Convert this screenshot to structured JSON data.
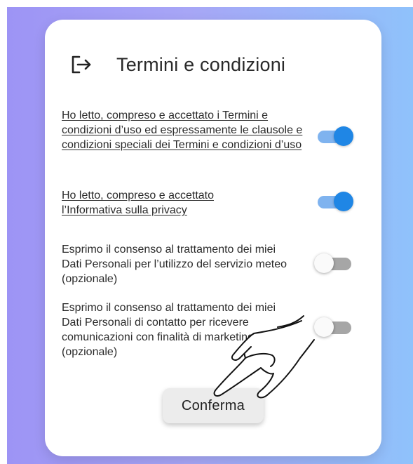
{
  "header": {
    "icon": "logout-icon",
    "title": "Termini e condizioni"
  },
  "consents": [
    {
      "text": "Ho letto, compreso e accettato i Termini e condizioni d’uso ed espressamente le clausole e condizioni speciali dei Termini e condizioni d’uso",
      "is_link": true,
      "enabled": true
    },
    {
      "text": "Ho letto, compreso e accettato l’Informativa sulla privacy",
      "is_link": true,
      "enabled": true
    },
    {
      "text": "Esprimo il consenso al trattamento dei miei Dati Personali per l’utilizzo del servizio meteo (opzionale)",
      "is_link": false,
      "enabled": false
    },
    {
      "text": "Esprimo il consenso al trattamento dei miei Dati Personali di contatto per ricevere comunicazioni con finalità di marketing (opzionale)",
      "is_link": false,
      "enabled": false
    }
  ],
  "confirm_button": {
    "label": "Conferma"
  },
  "colors": {
    "toggle_on_thumb": "#1f86e5",
    "toggle_on_track": "#7fb3ef",
    "toggle_off_track": "#a6a6a6",
    "background_start": "#9d94f5",
    "background_end": "#8fc2fb"
  }
}
